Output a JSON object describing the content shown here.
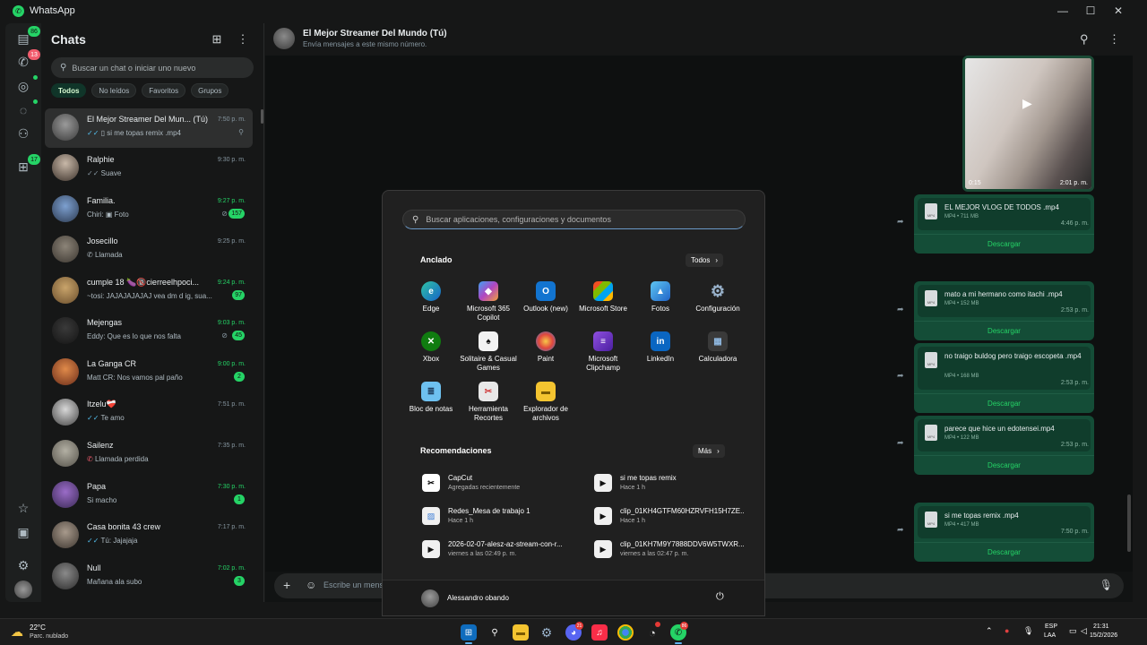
{
  "window": {
    "title": "WhatsApp",
    "minimize": "—",
    "maximize": "☐",
    "close": "✕"
  },
  "rail": {
    "chats_badge": "86",
    "calls_badge": "13",
    "communities_badge": "17"
  },
  "chatlist": {
    "title": "Chats",
    "search_placeholder": "Buscar un chat o iniciar uno nuevo",
    "filters": [
      "Todos",
      "No leídos",
      "Favoritos",
      "Grupos"
    ],
    "chats": [
      {
        "name": "El Mejor Streamer Del Mun... (Tú)",
        "time": "7:50 p. m.",
        "preview": "si me topas remix .mp4",
        "pinned": true
      },
      {
        "name": "Ralphie",
        "time": "9:30 p. m.",
        "preview": "Suave"
      },
      {
        "name": "Familia.",
        "time": "9:27 p. m.",
        "preview": "Chiri: ▣ Foto",
        "badge": "157"
      },
      {
        "name": "Josecillo",
        "time": "9:25 p. m.",
        "preview": "Llamada"
      },
      {
        "name": "cumple 18 🍆🔞cierreelhpoci...",
        "time": "9:24 p. m.",
        "preview": "~tosi: JAJAJAJAJAJ vea dm d ig, sua...",
        "badge": "97"
      },
      {
        "name": "Mejengas",
        "time": "9:03 p. m.",
        "preview": "Eddy: Que es lo que nos falta",
        "badge": "45"
      },
      {
        "name": "La Ganga CR",
        "time": "9:00 p. m.",
        "preview": "Matt CR: Nos vamos pal paño",
        "badge": "2"
      },
      {
        "name": "Itzelu❤️‍🩹",
        "time": "7:51 p. m.",
        "preview": "Te amo"
      },
      {
        "name": "Sailenz",
        "time": "7:35 p. m.",
        "preview": "Llamada perdida"
      },
      {
        "name": "Papa",
        "time": "7:30 p. m.",
        "preview": "Si macho",
        "badge": "1"
      },
      {
        "name": "Casa bonita 43 crew",
        "time": "7:17 p. m.",
        "preview": "Tú: Jajajaja"
      },
      {
        "name": "Null",
        "time": "7:02 p. m.",
        "preview": "Mañana ala subo",
        "badge": "3"
      }
    ]
  },
  "conversation": {
    "name": "El Mejor Streamer Del Mundo (Tú)",
    "subtitle": "Envía mensajes a este mismo número.",
    "video": {
      "duration": "0:15",
      "time": "2:01 p. m."
    },
    "messages": [
      {
        "name": "EL MEJOR VLOG DE TODOS .mp4",
        "meta": "MP4 • 711 MB",
        "time": "4:46 p. m.",
        "action": "Descargar"
      },
      {
        "name": "mato a mi hermano como itachi .mp4",
        "meta": "MP4 • 152 MB",
        "time": "2:53 p. m.",
        "action": "Descargar"
      },
      {
        "name": "no traigo buldog pero traigo escopeta .mp4",
        "meta": "MP4 • 168 MB",
        "time": "2:53 p. m.",
        "action": "Descargar"
      },
      {
        "name": "parece que hice un edotensei.mp4",
        "meta": "MP4 • 122 MB",
        "time": "2:53 p. m.",
        "action": "Descargar"
      },
      {
        "name": "si me topas remix .mp4",
        "meta": "MP4 • 417 MB",
        "time": "7:50 p. m.",
        "action": "Descargar"
      }
    ],
    "composer_placeholder": "Escribe un mensaje"
  },
  "start_menu": {
    "search_placeholder": "Buscar aplicaciones, configuraciones y documentos",
    "pinned_title": "Anclado",
    "all_button": "Todos",
    "apps": [
      "Edge",
      "Microsoft 365 Copilot",
      "Outlook (new)",
      "Microsoft Store",
      "Fotos",
      "Configuración",
      "Xbox",
      "Solitaire & Casual Games",
      "Paint",
      "Microsoft Clipchamp",
      "LinkedIn",
      "Calculadora",
      "Bloc de notas",
      "Herramienta Recortes",
      "Explorador de archivos"
    ],
    "recs_title": "Recomendaciones",
    "more_button": "Más",
    "recommendations": [
      {
        "title": "CapCut",
        "sub": "Agregadas recientemente"
      },
      {
        "title": "si me topas remix",
        "sub": "Hace 1 h"
      },
      {
        "title": "Redes_Mesa de trabajo 1",
        "sub": "Hace 1 h"
      },
      {
        "title": "clip_01KH4GTFM60HZRVFH15H7ZE...",
        "sub": "Hace 1 h"
      },
      {
        "title": "2026-02-07-alesz-az-stream-con-r...",
        "sub": "viernes a las 02:49 p. m."
      },
      {
        "title": "clip_01KH7M9Y7888DDV6W5TWXR...",
        "sub": "viernes a las 02:47 p. m."
      }
    ],
    "user": "Alessandro obando"
  },
  "taskbar": {
    "weather_temp": "22°C",
    "weather_desc": "Parc. nublado",
    "discord_badge": "21",
    "whatsapp_badge": "86",
    "lang1": "ESP",
    "lang2": "LAA",
    "time": "21:31",
    "date": "15/2/2026"
  }
}
